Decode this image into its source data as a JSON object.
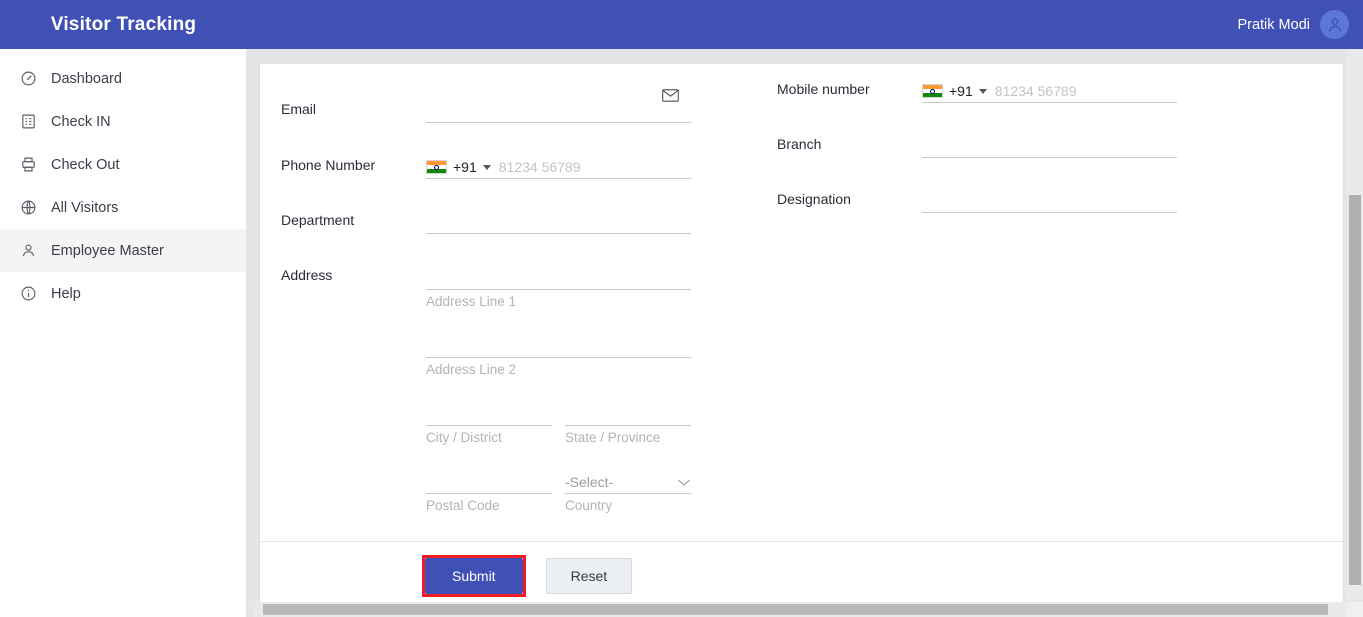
{
  "app": {
    "brand_title": "Visitor Tracking",
    "accent_color": "#3f51b5",
    "highlight_color": "#ee1c25"
  },
  "header": {
    "user_name": "Pratik Modi",
    "avatar_icon": "person-avatar-icon"
  },
  "sidebar": {
    "items": [
      {
        "label": "Dashboard",
        "icon": "speedometer-icon",
        "active": false
      },
      {
        "label": "Check IN",
        "icon": "clipboard-list-icon",
        "active": false
      },
      {
        "label": "Check Out",
        "icon": "printer-receipt-icon",
        "active": false
      },
      {
        "label": "All Visitors",
        "icon": "globe-icon",
        "active": false
      },
      {
        "label": "Employee Master",
        "icon": "person-icon",
        "active": true
      },
      {
        "label": "Help",
        "icon": "info-circle-icon",
        "active": false
      }
    ]
  },
  "form": {
    "left": {
      "email": {
        "label": "Email",
        "value": "",
        "placeholder": "",
        "icon": "envelope-icon"
      },
      "phone": {
        "label": "Phone Number",
        "country_code": "+91",
        "flag": "india-flag-icon",
        "value": "",
        "placeholder": "81234 56789"
      },
      "department": {
        "label": "Department",
        "value": "",
        "placeholder": ""
      },
      "address": {
        "label": "Address",
        "line1": {
          "value": "",
          "hint": "Address Line 1"
        },
        "line2": {
          "value": "",
          "hint": "Address Line 2"
        },
        "city": {
          "value": "",
          "hint": "City / District"
        },
        "state": {
          "value": "",
          "hint": "State / Province"
        },
        "postal": {
          "value": "",
          "hint": "Postal Code"
        },
        "country": {
          "selected": "-Select-",
          "hint": "Country",
          "icon": "chevron-down-icon"
        }
      }
    },
    "right": {
      "mobile": {
        "label": "Mobile number",
        "country_code": "+91",
        "flag": "india-flag-icon",
        "value": "",
        "placeholder": "81234 56789"
      },
      "branch": {
        "label": "Branch",
        "value": "",
        "placeholder": ""
      },
      "designation": {
        "label": "Designation",
        "value": "",
        "placeholder": ""
      }
    }
  },
  "footer": {
    "submit_label": "Submit",
    "reset_label": "Reset"
  }
}
